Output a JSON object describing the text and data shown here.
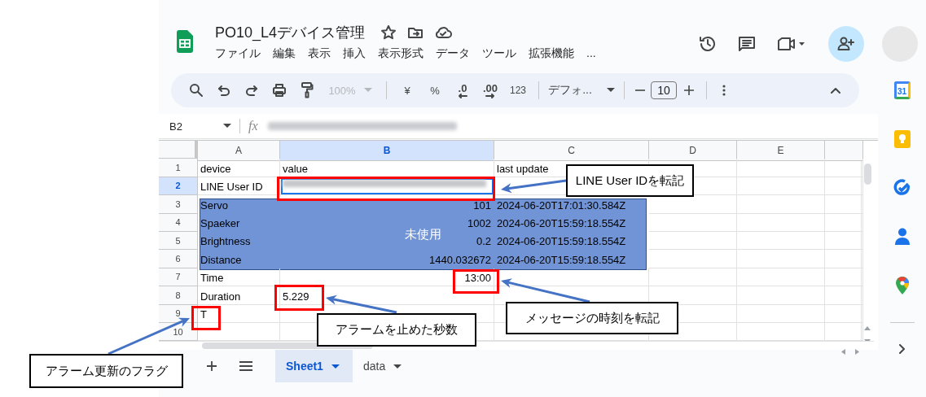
{
  "header": {
    "title": "PO10_L4デバイス管理",
    "menu": [
      "ファイル",
      "編集",
      "表示",
      "挿入",
      "表示形式",
      "データ",
      "ツール",
      "拡張機能",
      "..."
    ]
  },
  "toolbar": {
    "zoom": {
      "value": "100%",
      "disabled": true
    },
    "currency": "¥",
    "percent": "%",
    "decrease_decimals": ".0",
    "increase_decimals": ".00",
    "number_format": "123",
    "font": "デフォ...",
    "font_size": "10"
  },
  "formula_bar": {
    "cell_ref": "B2",
    "function_label": "fx",
    "value_blurred": true
  },
  "grid": {
    "columns": [
      {
        "label": "A",
        "selected": false
      },
      {
        "label": "B",
        "selected": true
      },
      {
        "label": "C",
        "selected": false
      },
      {
        "label": "D",
        "selected": false
      },
      {
        "label": "E",
        "selected": false
      }
    ],
    "rows": [
      {
        "number": "1",
        "selected": false,
        "cells": [
          {
            "kind": "text",
            "text": "device"
          },
          {
            "kind": "text",
            "text": "value"
          },
          {
            "kind": "text",
            "text": "last update"
          }
        ]
      },
      {
        "number": "2",
        "selected": true,
        "cells": [
          {
            "kind": "text",
            "text": "LINE User ID"
          },
          {
            "kind": "blurred",
            "selected": true
          },
          {
            "kind": "empty"
          }
        ]
      },
      {
        "number": "3",
        "selected": false,
        "cells": [
          {
            "kind": "text",
            "text": "Servo"
          },
          {
            "kind": "number",
            "text": "101"
          },
          {
            "kind": "text",
            "text": "2024-06-20T17:01:30.584Z"
          }
        ]
      },
      {
        "number": "4",
        "selected": false,
        "cells": [
          {
            "kind": "text",
            "text": "Spaeker"
          },
          {
            "kind": "number",
            "text": "1002"
          },
          {
            "kind": "text",
            "text": "2024-06-20T15:59:18.554Z"
          }
        ]
      },
      {
        "number": "5",
        "selected": false,
        "cells": [
          {
            "kind": "text",
            "text": "Brightness"
          },
          {
            "kind": "number",
            "text": "0.2"
          },
          {
            "kind": "text",
            "text": "2024-06-20T15:59:18.554Z"
          }
        ]
      },
      {
        "number": "6",
        "selected": false,
        "cells": [
          {
            "kind": "text",
            "text": "Distance"
          },
          {
            "kind": "number",
            "text": "1440.032672"
          },
          {
            "kind": "text",
            "text": "2024-06-20T15:59:18.554Z"
          }
        ]
      },
      {
        "number": "7",
        "selected": false,
        "cells": [
          {
            "kind": "text",
            "text": "Time"
          },
          {
            "kind": "number",
            "text": "13:00"
          },
          {
            "kind": "empty"
          }
        ]
      },
      {
        "number": "8",
        "selected": false,
        "cells": [
          {
            "kind": "text",
            "text": "Duration"
          },
          {
            "kind": "text",
            "text": "5.229"
          },
          {
            "kind": "empty"
          }
        ]
      },
      {
        "number": "9",
        "selected": false,
        "cells": [
          {
            "kind": "text",
            "text": "T"
          },
          {
            "kind": "empty"
          },
          {
            "kind": "empty"
          }
        ]
      },
      {
        "number": "10",
        "selected": false,
        "cells": [
          {
            "kind": "empty"
          },
          {
            "kind": "empty"
          },
          {
            "kind": "empty"
          }
        ]
      }
    ],
    "overlay": {
      "label": "未使用"
    }
  },
  "sheet_tabs": [
    {
      "label": "Sheet1",
      "selected": true
    },
    {
      "label": "data",
      "selected": false
    }
  ],
  "side_panel": {
    "calendar_day": "31"
  },
  "annotations": [
    {
      "text": "LINE User IDを転記"
    },
    {
      "text": "メッセージの時刻を転記"
    },
    {
      "text": "アラームを止めた秒数"
    },
    {
      "text": "アラーム更新のフラグ"
    }
  ]
}
